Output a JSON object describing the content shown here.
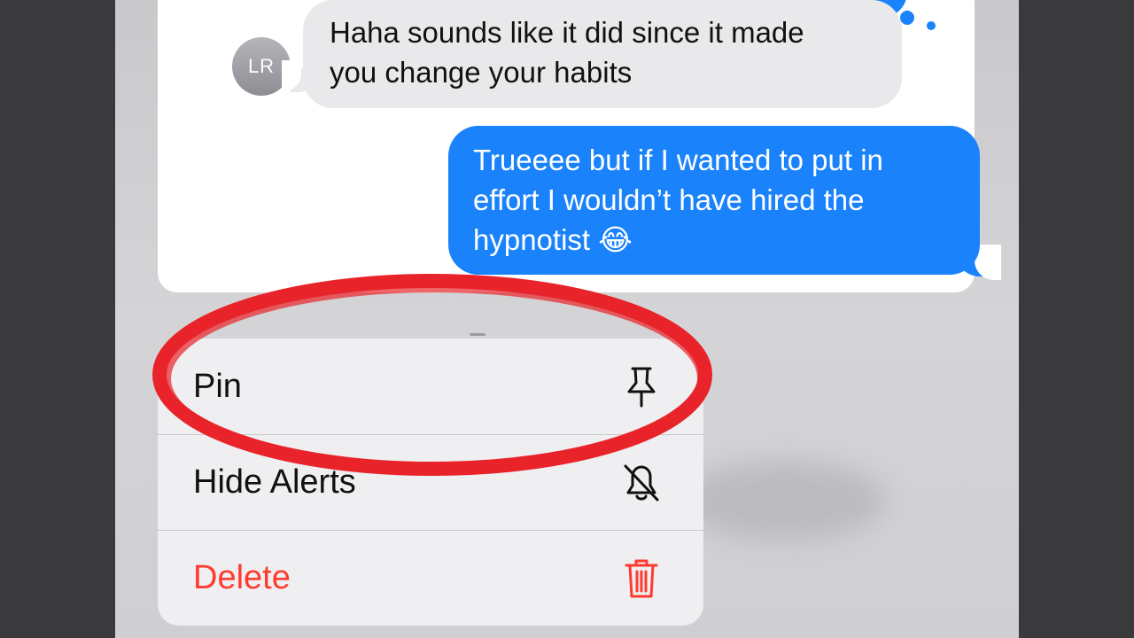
{
  "conversation": {
    "avatar_initials": "LR",
    "incoming_message": {
      "line1": "Haha sounds like it did since it made",
      "line2": "you change your habits"
    },
    "outgoing_message": {
      "line1": "Trueeee but if I wanted to put in",
      "line2": "effort I wouldn’t have hired the",
      "line3": "hypnotist 😂"
    }
  },
  "context_menu": {
    "items": [
      {
        "label": "Pin",
        "icon": "pin-icon",
        "style": "default"
      },
      {
        "label": "Hide Alerts",
        "icon": "bell-slash-icon",
        "style": "default"
      },
      {
        "label": "Delete",
        "icon": "trash-icon",
        "style": "destructive"
      }
    ]
  },
  "annotation": {
    "type": "red-ellipse",
    "highlights": "Pin",
    "color": "#e8232a"
  },
  "colors": {
    "outgoing_bubble": "#1a82fb",
    "incoming_bubble": "#e9e9eb",
    "destructive": "#ff3b30",
    "menu_background": "#efeff1"
  }
}
